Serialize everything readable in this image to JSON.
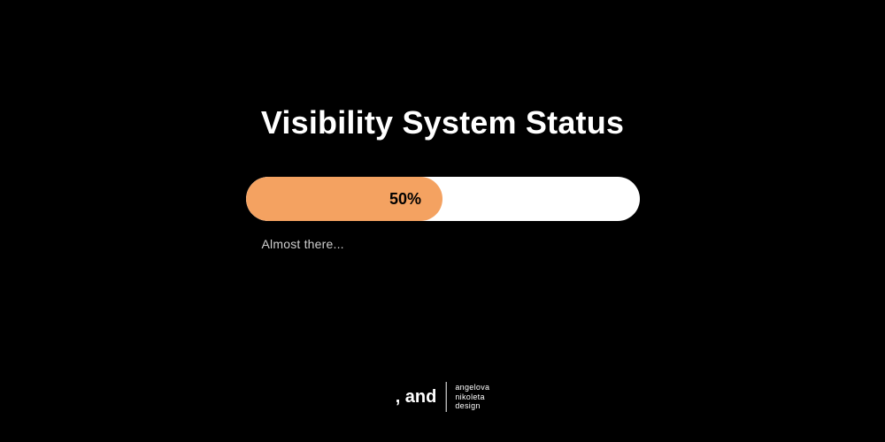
{
  "title": "Visibility System Status",
  "progress": {
    "percent": 50,
    "label": "50%"
  },
  "status_text": "Almost there...",
  "brand": {
    "left": ", and",
    "right": {
      "line1": "angelova",
      "line2": "nikoleta",
      "line3": "design"
    }
  },
  "colors": {
    "background": "#000000",
    "progress_fill": "#f4a261",
    "progress_track": "#ffffff",
    "text": "#ffffff"
  }
}
